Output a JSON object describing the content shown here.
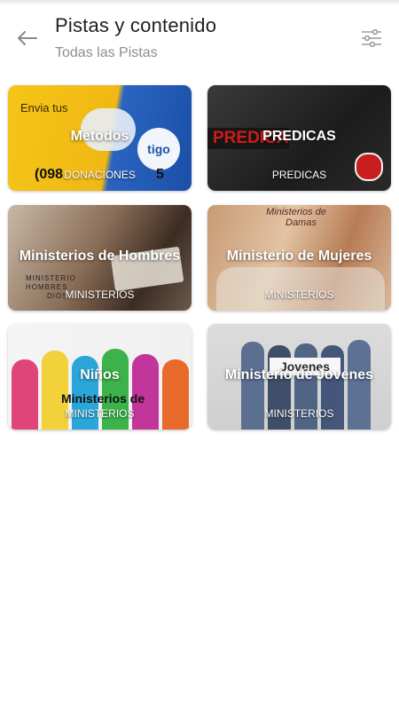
{
  "header": {
    "title": "Pistas y contenido",
    "subtitle": "Todas las Pistas",
    "back_icon": "arrow-left-icon",
    "filter_icon": "sliders-icon"
  },
  "cards": [
    {
      "title": "Metodos",
      "category": "DONACIONES",
      "decor": [
        "Envia tus",
        "tigo",
        "(098",
        "5"
      ]
    },
    {
      "title": "PREDICAS",
      "category": "PREDICAS",
      "decor": [
        "PREDICA"
      ]
    },
    {
      "title": "Ministerios de Hombres",
      "category": "MINISTERIOS",
      "decor": [
        "MINISTERIO",
        "HOMBRES",
        "DIOS"
      ]
    },
    {
      "title": "Ministerio de Mujeres",
      "category": "MINISTERIOS",
      "decor": [
        "Ministerios de",
        "Damas"
      ]
    },
    {
      "title": "Niños",
      "category": "MINISTERIOS",
      "decor": [
        "Ministerios de"
      ]
    },
    {
      "title": "Ministerio de Jovenes",
      "category": "MINISTERIOS",
      "decor": [
        "Jovenes"
      ]
    }
  ],
  "colors": {
    "donaciones": "#f0c21a",
    "tigo_blue": "#1b4fa8",
    "predica_red": "#d21a1a"
  }
}
